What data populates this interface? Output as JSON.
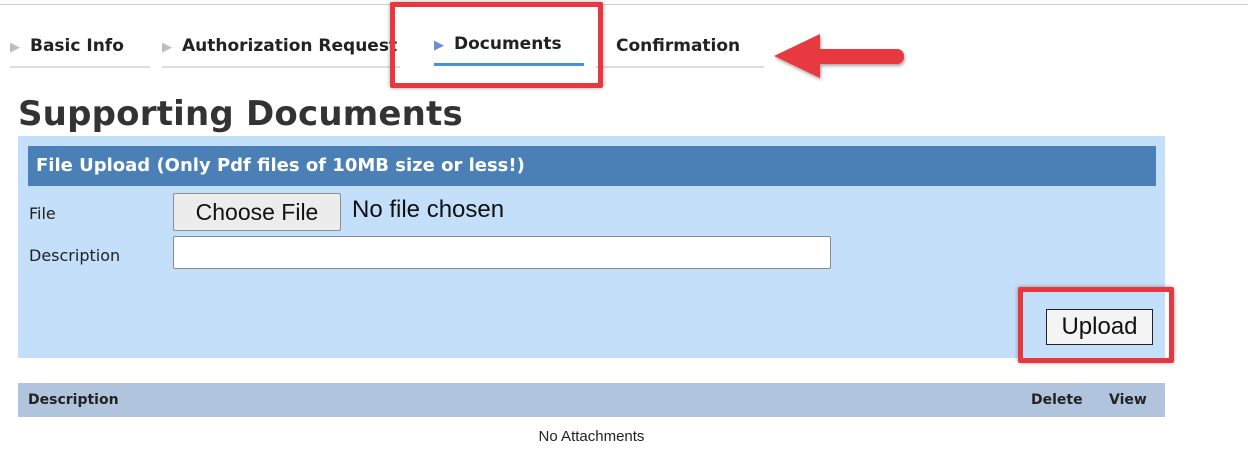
{
  "tabs": [
    {
      "label": "Basic Info",
      "arrow_icon": "triangle-right-icon",
      "active": false
    },
    {
      "label": "Authorization Request",
      "arrow_icon": "triangle-right-icon",
      "active": false
    },
    {
      "label": "Documents",
      "arrow_icon": "triangle-right-icon",
      "active": true
    },
    {
      "label": "Confirmation",
      "active": false
    }
  ],
  "page": {
    "title": "Supporting Documents"
  },
  "upload_panel": {
    "header": "File Upload (Only Pdf files of 10MB size or less!)",
    "file_label": "File",
    "choose_button": "Choose File",
    "file_status": "No file chosen",
    "description_label": "Description",
    "description_value": "",
    "upload_button": "Upload"
  },
  "attachments_table": {
    "columns": [
      "Description",
      "Delete",
      "View"
    ],
    "empty_text": "No Attachments"
  },
  "colors": {
    "highlight": "#e8373f",
    "panel_bg": "#c4dffa",
    "panel_header": "#4a80b5",
    "table_header": "#b0c4de",
    "active_tab_underline": "#4a90e2"
  }
}
